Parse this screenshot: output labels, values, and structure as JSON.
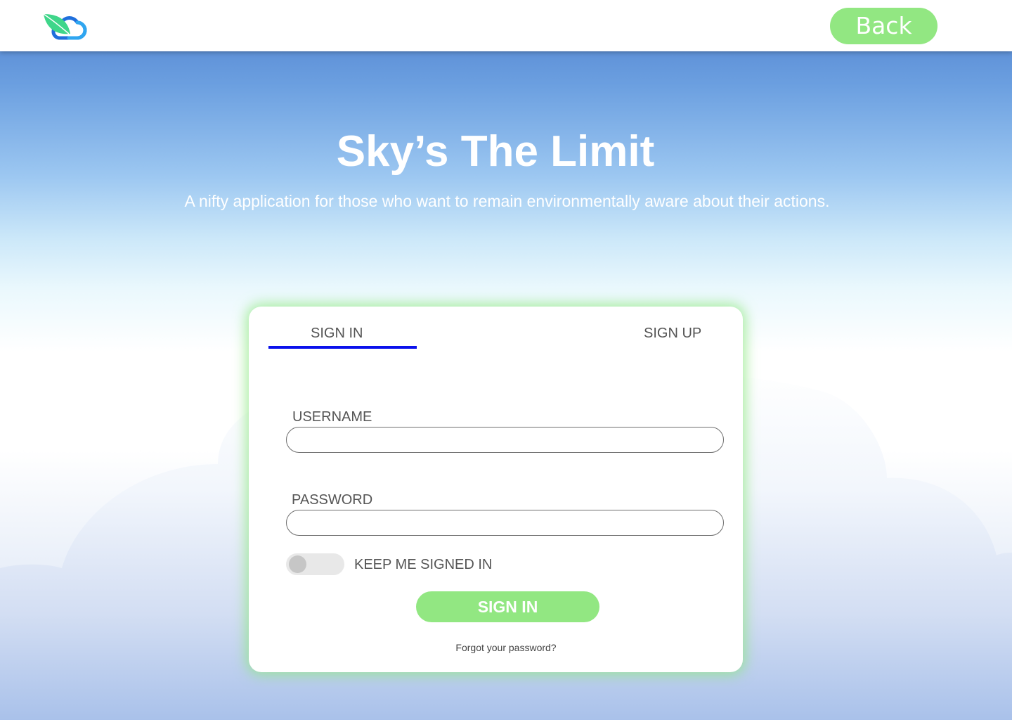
{
  "header": {
    "back_label": "Back"
  },
  "hero": {
    "title": "Sky’s The Limit",
    "subtitle": "A nifty application for those who want to remain environmentally aware about their actions."
  },
  "auth": {
    "tabs": [
      {
        "label": "SIGN IN",
        "active": true
      },
      {
        "label": "SIGN UP",
        "active": false
      }
    ],
    "username_label": "USERNAME",
    "username_value": "",
    "password_label": "PASSWORD",
    "password_value": "",
    "keep_signed_in_label": "KEEP ME SIGNED IN",
    "keep_signed_in": false,
    "submit_label": "SIGN IN",
    "forgot_label": "Forgot your password?"
  },
  "colors": {
    "accent_green": "#92e782",
    "tab_underline": "#0b12ec",
    "sky_top": "#4e7fcd",
    "text_gray": "#555555"
  },
  "icons": {
    "logo": "leaf-cloud-logo-icon"
  }
}
